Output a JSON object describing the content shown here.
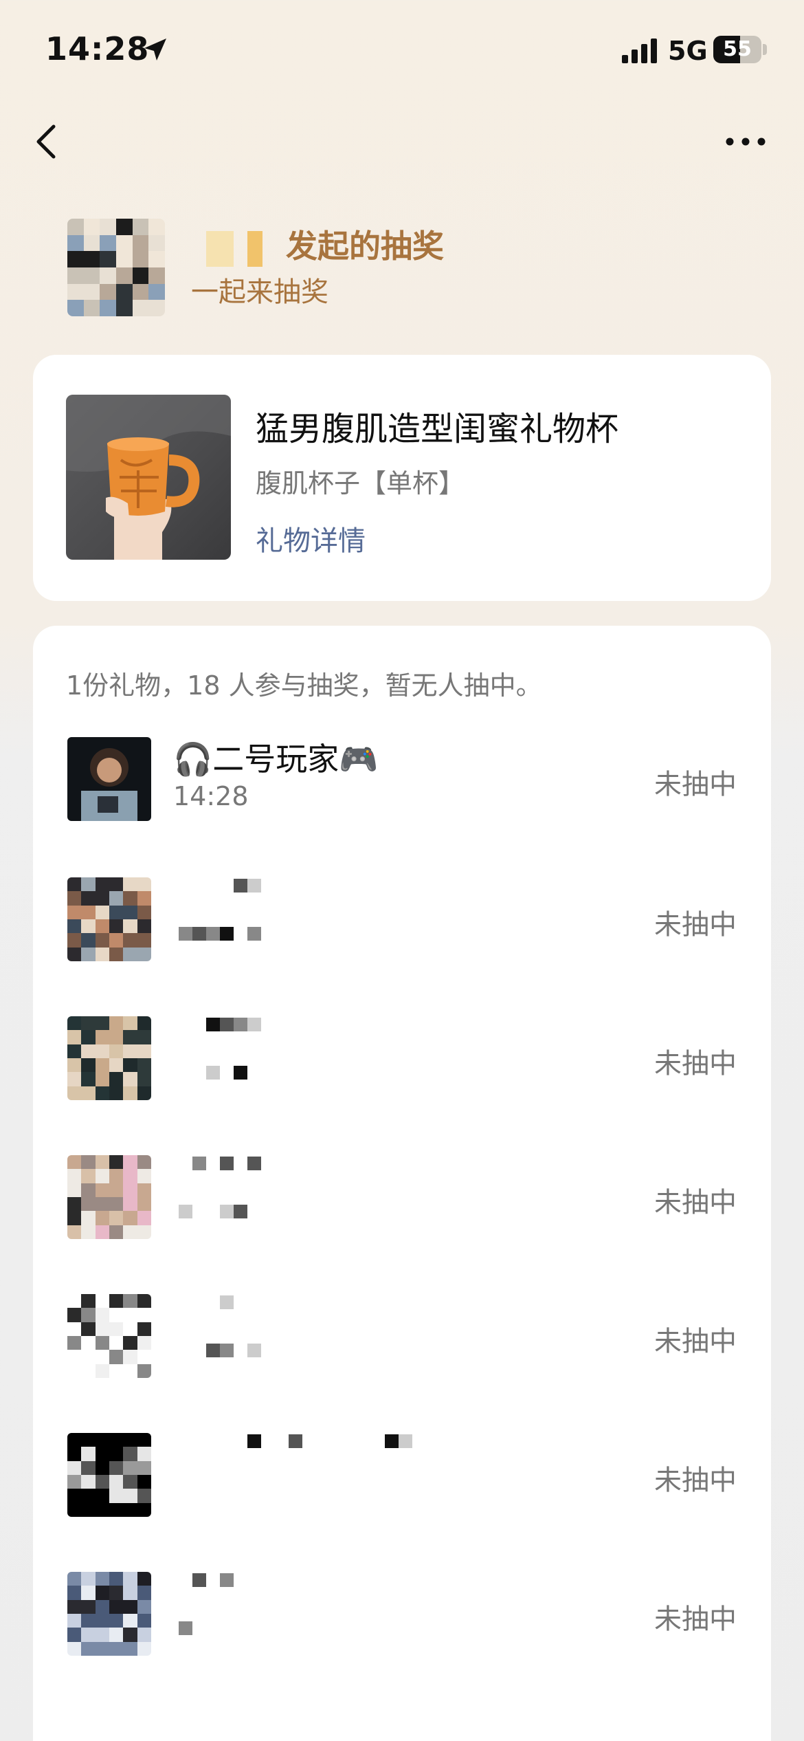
{
  "status_bar": {
    "time": "14:28",
    "network": "5G",
    "battery": "55",
    "battery_level": 0.55
  },
  "nav": {
    "back_icon": "chevron-left-icon",
    "more_icon": "more-icon"
  },
  "header": {
    "title": "发起的抽奖",
    "subtitle": "一起来抽奖"
  },
  "gift": {
    "name": "猛男腹肌造型闺蜜礼物杯",
    "variant": "腹肌杯子【单杯】",
    "detail_link": "礼物详情"
  },
  "lottery": {
    "summary": "1份礼物，18 人参与抽奖，暂无人抽中。",
    "participants": [
      {
        "name": "🎧二号玩家🎮",
        "time": "14:28",
        "status": "未抽中"
      },
      {
        "name": "",
        "time": "",
        "status": "未抽中"
      },
      {
        "name": "",
        "time": "",
        "status": "未抽中"
      },
      {
        "name": "",
        "time": "",
        "status": "未抽中"
      },
      {
        "name": "",
        "time": "",
        "status": "未抽中"
      },
      {
        "name": "",
        "time": "",
        "status": "未抽中"
      },
      {
        "name": "",
        "time": "",
        "status": "未抽中"
      }
    ]
  }
}
